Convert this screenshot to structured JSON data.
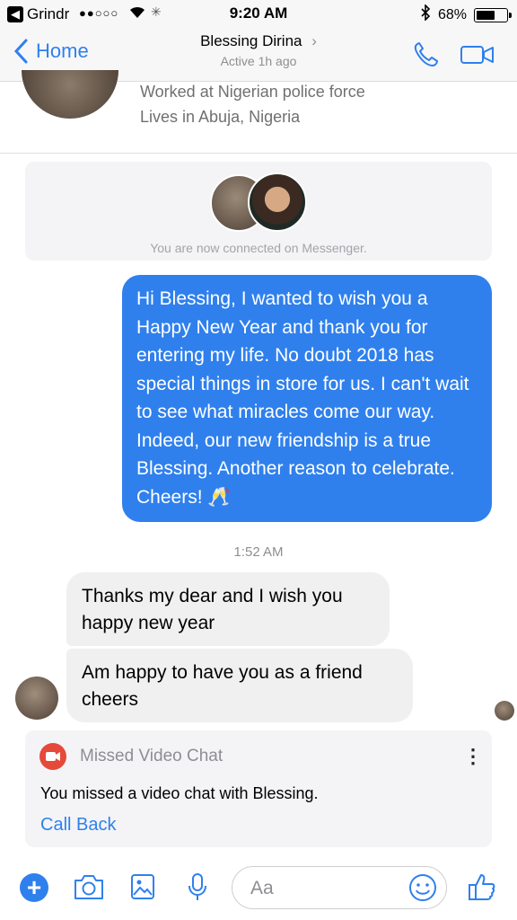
{
  "status_bar": {
    "back_app": "Grindr",
    "signal": "●●○○○",
    "time": "9:20 AM",
    "battery": "68%",
    "battery_level": 0.68
  },
  "nav": {
    "back_label": "Home",
    "contact_name": "Blessing Dirina",
    "contact_status": "Active 1h ago"
  },
  "profile": {
    "work": "Worked at Nigerian police force",
    "location": "Lives in Abuja, Nigeria"
  },
  "connected": {
    "text": "You are now connected on Messenger."
  },
  "messages": {
    "outgoing_1": "Hi Blessing, I wanted to wish you a Happy New Year and thank you for entering my life. No doubt 2018 has special things in store for us. I can't wait to see what miracles come our way. Indeed, our new friendship is a true Blessing. Another reason to celebrate. Cheers! 🥂",
    "timestamp": "1:52 AM",
    "incoming_1": "Thanks my dear and I wish you happy new year",
    "incoming_2": "Am happy to have you as a friend cheers"
  },
  "missed_call": {
    "title": "Missed Video Chat",
    "body": "You missed a video chat with Blessing.",
    "action": "Call Back",
    "menu": "⋮"
  },
  "composer": {
    "placeholder": "Aa",
    "plus": "+"
  },
  "colors": {
    "accent": "#2f80ed",
    "bubble_incoming": "#f0f0f0",
    "card_bg": "#f4f4f6",
    "missed_red": "#e4493a"
  },
  "icons": [
    "back-chevron-icon",
    "info-chevron-icon",
    "phone-icon",
    "video-camera-icon",
    "camera-icon",
    "gallery-icon",
    "microphone-icon",
    "emoji-icon",
    "thumbs-up-icon",
    "wifi-icon",
    "bluetooth-icon",
    "battery-icon"
  ]
}
